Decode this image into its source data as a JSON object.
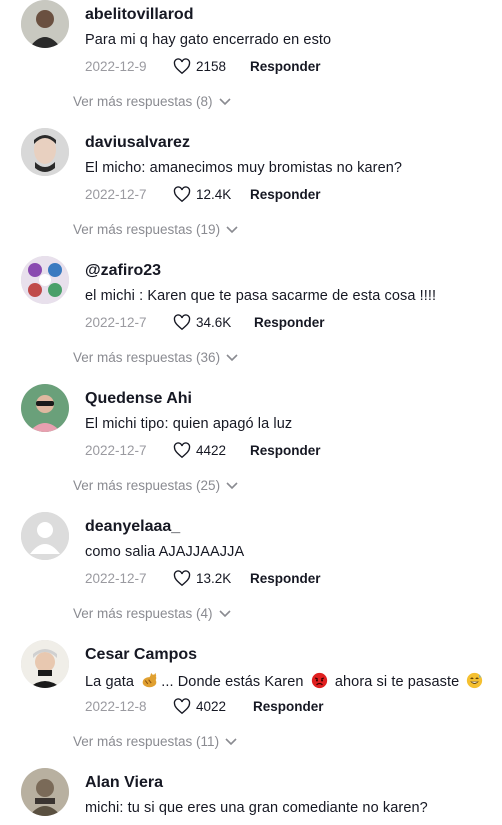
{
  "comments": [
    {
      "username": "abelitovillarod",
      "text": "Para mi q hay gato encerrado en esto",
      "date": "2022-12-9",
      "likes": "2158",
      "reply_label": "Responder",
      "more_replies": "Ver más respuestas (8)",
      "avatar_color": "#3b3a3a"
    },
    {
      "username": "daviusalvarez",
      "text": "El micho: amanecimos muy bromistas no karen?",
      "date": "2022-12-7",
      "likes": "12.4K",
      "reply_label": "Responder",
      "more_replies": "Ver más respuestas (19)",
      "avatar_color": "#c9c9c9"
    },
    {
      "username": "@zafiro23",
      "text": "el michi : Karen que te pasa sacarme de esta cosa !!!!",
      "date": "2022-12-7",
      "likes": "34.6K",
      "reply_label": "Responder",
      "more_replies": "Ver más respuestas (36)",
      "avatar_color": "#6b4a7a"
    },
    {
      "username": "Quedense Ahi",
      "text": "El michi tipo: quien apagó la luz",
      "date": "2022-12-7",
      "likes": "4422",
      "reply_label": "Responder",
      "more_replies": "Ver más respuestas (25)",
      "avatar_color": "#5d8a6a"
    },
    {
      "username": "deanyelaaa_",
      "text": "como salia AJAJJAAJJA",
      "date": "2022-12-7",
      "likes": "13.2K",
      "reply_label": "Responder",
      "more_replies": "Ver más respuestas (4)",
      "avatar_color": "#d6d6d6"
    },
    {
      "username": "Cesar Campos",
      "text_parts": [
        "La gata ",
        "... Donde estás Karen ",
        " ahora si te pasaste "
      ],
      "date": "2022-12-8",
      "likes": "4022",
      "reply_label": "Responder",
      "more_replies": "Ver más respuestas (11)",
      "avatar_color": "#e8e6e0"
    },
    {
      "username": "Alan Viera",
      "text": "michi: tu si que eres una gran comediante no karen?",
      "avatar_color": "#8a8070"
    }
  ]
}
